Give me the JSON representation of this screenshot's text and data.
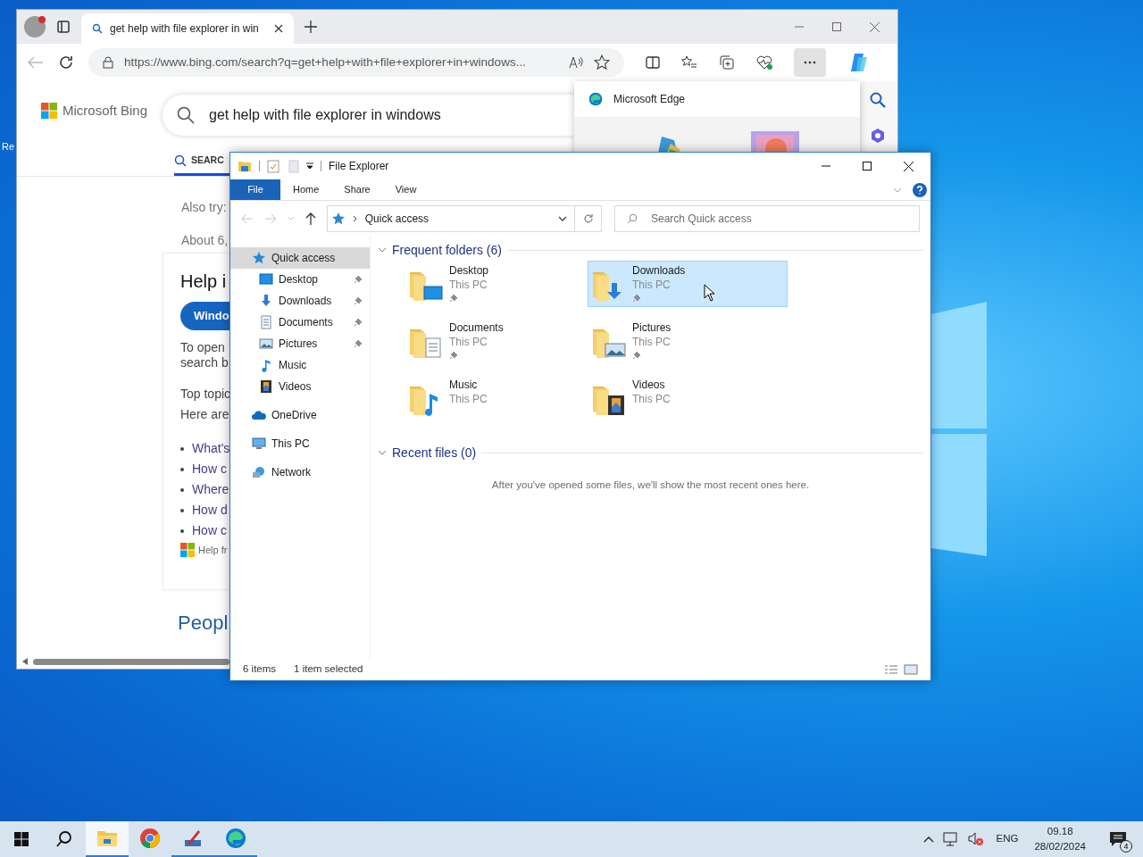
{
  "desktop": {
    "icon_label": "Re"
  },
  "browser": {
    "tab": {
      "title": "get help with file explorer in win",
      "selected": true
    },
    "url": "https://www.bing.com/search?q=get+help+with+file+explorer+in+windows...",
    "logo": "Microsoft Bing",
    "query": "get help with file explorer in windows",
    "search_tab": "SEARC",
    "also_try": "Also try:",
    "result_count": "About 6,",
    "card": {
      "title": "Help i",
      "button": "Windo",
      "lines": [
        "To open",
        "search b"
      ],
      "topics": "Top topic",
      "intro": "Here are",
      "links": [
        "What's",
        "How c",
        "Where",
        "How d",
        "How c"
      ],
      "source": "Help fr"
    },
    "people": "Peopl",
    "edge_popup": {
      "title": "Microsoft Edge"
    }
  },
  "explorer": {
    "title": "File Explorer",
    "ribbon_tabs": [
      {
        "label": "File",
        "selected": true
      },
      {
        "label": "Home",
        "selected": false
      },
      {
        "label": "Share",
        "selected": false
      },
      {
        "label": "View",
        "selected": false
      }
    ],
    "address": "Quick access",
    "search": {
      "placeholder": "Search Quick access"
    },
    "nav": [
      {
        "label": "Quick access",
        "kind": "star",
        "selected": true,
        "children": [
          {
            "label": "Desktop",
            "kind": "desktop",
            "pinned": true,
            "selected": false
          },
          {
            "label": "Downloads",
            "kind": "downloads",
            "pinned": true,
            "selected": false
          },
          {
            "label": "Documents",
            "kind": "documents",
            "pinned": true,
            "selected": false
          },
          {
            "label": "Pictures",
            "kind": "pictures",
            "pinned": true,
            "selected": false
          },
          {
            "label": "Music",
            "kind": "music",
            "pinned": false,
            "selected": false
          },
          {
            "label": "Videos",
            "kind": "videos",
            "pinned": false,
            "selected": false
          }
        ]
      },
      {
        "label": "OneDrive",
        "kind": "onedrive",
        "selected": false
      },
      {
        "label": "This PC",
        "kind": "pc",
        "selected": false
      },
      {
        "label": "Network",
        "kind": "network",
        "selected": false
      }
    ],
    "frequent": {
      "title": "Frequent folders (6)",
      "expanded": true,
      "folders": [
        {
          "name": "Desktop",
          "location": "This PC",
          "kind": "desktop",
          "pinned": true,
          "selected": false
        },
        {
          "name": "Downloads",
          "location": "This PC",
          "kind": "downloads",
          "pinned": true,
          "selected": true
        },
        {
          "name": "Documents",
          "location": "This PC",
          "kind": "documents",
          "pinned": true,
          "selected": false
        },
        {
          "name": "Pictures",
          "location": "This PC",
          "kind": "pictures",
          "pinned": true,
          "selected": false
        },
        {
          "name": "Music",
          "location": "This PC",
          "kind": "music",
          "pinned": false,
          "selected": false
        },
        {
          "name": "Videos",
          "location": "This PC",
          "kind": "videos",
          "pinned": false,
          "selected": false
        }
      ]
    },
    "recent": {
      "title": "Recent files (0)",
      "expanded": true,
      "message": "After you've opened some files, we'll show the most recent ones here."
    },
    "status": {
      "count": "6 items",
      "selection": "1 item selected"
    }
  },
  "taskbar": {
    "apps": [
      {
        "kind": "explorer",
        "open": true,
        "selected": true
      },
      {
        "kind": "chrome",
        "open": false,
        "selected": false
      },
      {
        "kind": "tool",
        "open": true,
        "selected": false
      },
      {
        "kind": "edge",
        "open": true,
        "selected": false
      }
    ],
    "language": "ENG",
    "time": "09.18",
    "date": "28/02/2024",
    "notifications": "4"
  }
}
